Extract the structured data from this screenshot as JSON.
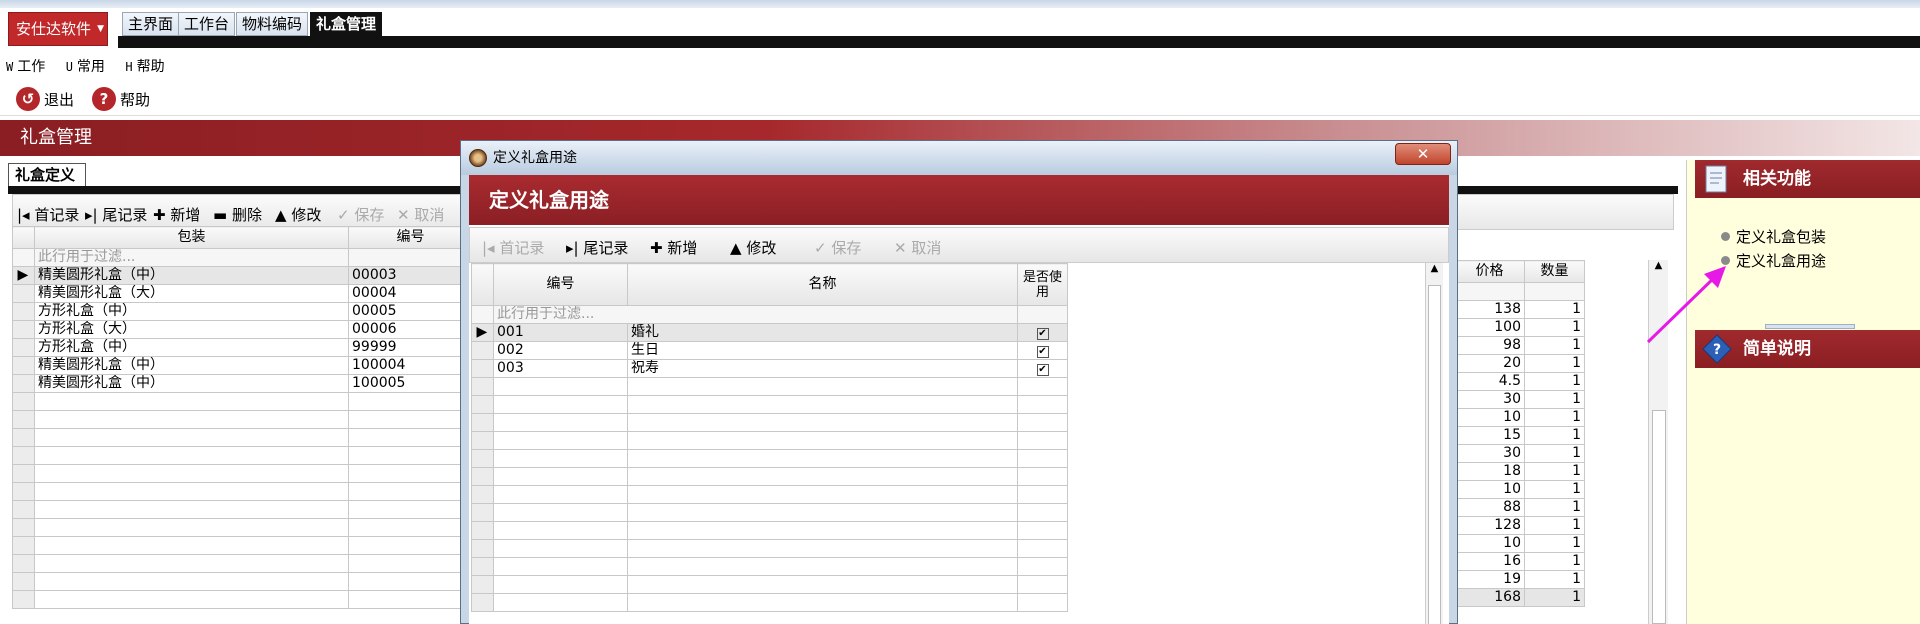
{
  "brand": {
    "label": "安仕达软件",
    "dropdown": "▼"
  },
  "top_tabs": [
    "主界面",
    "工作台",
    "物料编码",
    "礼盒管理"
  ],
  "menu": [
    {
      "key": "W",
      "label": "工作"
    },
    {
      "key": "U",
      "label": "常用"
    },
    {
      "key": "H",
      "label": "帮助"
    }
  ],
  "toolbar": {
    "exit": "退出",
    "help": "帮助"
  },
  "section_title": "礼盒管理",
  "left": {
    "tab": "礼盒定义",
    "toolbar": [
      "首记录",
      "尾记录",
      "新增",
      "删除",
      "修改",
      "保存",
      "取消"
    ],
    "columns": [
      "包装",
      "编号"
    ],
    "filter_text": "此行用于过滤...",
    "rows": [
      {
        "name": "精美圆形礼盒（中）",
        "code": "00003"
      },
      {
        "name": "精美圆形礼盒（大）",
        "code": "00004"
      },
      {
        "name": "方形礼盒（中）",
        "code": "00005"
      },
      {
        "name": "方形礼盒（大）",
        "code": "00006"
      },
      {
        "name": "方形礼盒（中）",
        "code": "99999"
      },
      {
        "name": "精美圆形礼盒（中）",
        "code": "100004"
      },
      {
        "name": "精美圆形礼盒（中）",
        "code": "100005"
      }
    ],
    "right_columns": [
      "价格",
      "数量"
    ],
    "right_rows": [
      [
        "138",
        "1"
      ],
      [
        "100",
        "1"
      ],
      [
        "98",
        "1"
      ],
      [
        "20",
        "1"
      ],
      [
        "4.5",
        "1"
      ],
      [
        "30",
        "1"
      ],
      [
        "10",
        "1"
      ],
      [
        "15",
        "1"
      ],
      [
        "30",
        "1"
      ],
      [
        "18",
        "1"
      ],
      [
        "10",
        "1"
      ],
      [
        "88",
        "1"
      ],
      [
        "128",
        "1"
      ],
      [
        "10",
        "1"
      ],
      [
        "16",
        "1"
      ],
      [
        "19",
        "1"
      ],
      [
        "168",
        "1"
      ]
    ]
  },
  "side": {
    "related_title": "相关功能",
    "links": [
      "定义礼盒包装",
      "定义礼盒用途"
    ],
    "notes_title": "简单说明"
  },
  "dialog": {
    "title": "定义礼盒用途",
    "close": "✕",
    "header": "定义礼盒用途",
    "toolbar": [
      "首记录",
      "尾记录",
      "新增",
      "修改",
      "保存",
      "取消"
    ],
    "columns": [
      "编号",
      "名称",
      "是否使用"
    ],
    "filter_text": "此行用于过滤...",
    "rows": [
      {
        "code": "001",
        "name": "婚礼",
        "used": "✔"
      },
      {
        "code": "002",
        "name": "生日",
        "used": "✔"
      },
      {
        "code": "003",
        "name": "祝寿",
        "used": "✔"
      }
    ]
  },
  "colors": {
    "accent": "#8a1e22",
    "brand": "#c0282a",
    "arrow": "#e619e6"
  }
}
